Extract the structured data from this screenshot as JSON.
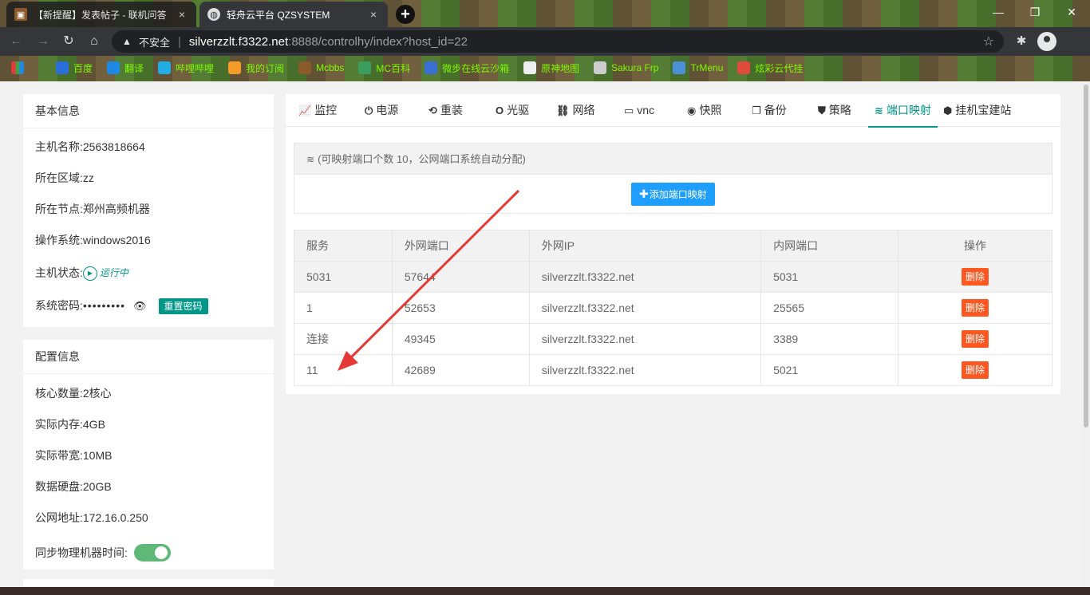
{
  "browser": {
    "tabs": [
      {
        "title": "【新提醒】发表帖子 - 联机问答",
        "active": false
      },
      {
        "title": "轻舟云平台 QZSYSTEM",
        "active": true
      }
    ],
    "address": {
      "security_label": "不安全",
      "host": "silverzzlt.f3322.net",
      "path": ":8888/controlhy/index?host_id=22"
    },
    "bookmarks": [
      {
        "label": "百度",
        "icon": "baidu-icon",
        "color": "#2a6ed8"
      },
      {
        "label": "翻译",
        "icon": "translate-icon",
        "color": "#1e88e5"
      },
      {
        "label": "哔哩哔哩",
        "icon": "bilibili-icon",
        "color": "#23ade5"
      },
      {
        "label": "我的订阅",
        "icon": "subscription-icon",
        "color": "#f59b2a"
      },
      {
        "label": "Mcbbs",
        "icon": "mcbbs-icon",
        "color": "#8b5a2b"
      },
      {
        "label": "MC百科",
        "icon": "mcmod-icon",
        "color": "#3a9d5d"
      },
      {
        "label": "微步在线云沙箱",
        "icon": "sandbox-icon",
        "color": "#3b6fd1"
      },
      {
        "label": "原神地图",
        "icon": "map-icon",
        "color": "#eeeeee"
      },
      {
        "label": "Sakura Frp",
        "icon": "sakura-icon",
        "color": "#cccccc"
      },
      {
        "label": "TrMenu",
        "icon": "trmenu-icon",
        "color": "#4a90d9"
      },
      {
        "label": "炫彩云代挂",
        "icon": "rocket-icon",
        "color": "#e04a3a"
      }
    ]
  },
  "basic_info": {
    "title": "基本信息",
    "rows": [
      {
        "label": "主机名称:",
        "value": "2563818664"
      },
      {
        "label": "所在区域:",
        "value": "zz"
      },
      {
        "label": "所在节点:",
        "value": "郑州高频机器"
      },
      {
        "label": "操作系统:",
        "value": "windows2016"
      }
    ],
    "status_label": "主机状态:",
    "status_value": "运行中",
    "password_label": "系统密码:",
    "password_mask": "•••••••••",
    "reset_label": "重置密码"
  },
  "config_info": {
    "title": "配置信息",
    "rows": [
      {
        "label": "核心数量:",
        "value": "2核心"
      },
      {
        "label": "实际内存:",
        "value": "4GB"
      },
      {
        "label": "实际带宽:",
        "value": "10MB"
      },
      {
        "label": "数据硬盘:",
        "value": "20GB"
      },
      {
        "label": "公网地址:",
        "value": "172.16.0.250"
      }
    ],
    "sync_label": "同步物理机器时间:",
    "sync_on": true
  },
  "control_tabs": [
    {
      "label": "监控",
      "icon": "chart-icon",
      "glyph": "📈"
    },
    {
      "label": "电源",
      "icon": "power-icon",
      "glyph": "⏻"
    },
    {
      "label": "重装",
      "icon": "retweet-icon",
      "glyph": "⟲"
    },
    {
      "label": "光驱",
      "icon": "disc-icon",
      "glyph": "O"
    },
    {
      "label": "网络",
      "icon": "sitemap-icon",
      "glyph": "⛓"
    },
    {
      "label": "vnc",
      "icon": "monitor-icon",
      "glyph": "▭"
    },
    {
      "label": "快照",
      "icon": "camera-icon",
      "glyph": "◉"
    },
    {
      "label": "备份",
      "icon": "copy-icon",
      "glyph": "❐"
    },
    {
      "label": "策略",
      "icon": "shield-icon",
      "glyph": "⛊"
    },
    {
      "label": "端口映射",
      "icon": "wifi-icon",
      "glyph": "≋",
      "active": true
    },
    {
      "label": "挂机宝建站",
      "icon": "cube-icon",
      "glyph": "⬢"
    }
  ],
  "port_mapping": {
    "notice": "(可映射端口个数 10，公网端口系统自动分配)",
    "add_label": "添加端口映射",
    "columns": [
      "服务",
      "外网端口",
      "外网IP",
      "内网端口",
      "操作"
    ],
    "rows": [
      {
        "service": "5031",
        "public_port": "57644",
        "public_ip": "silverzzlt.f3322.net",
        "private_port": "5031",
        "action": "删除"
      },
      {
        "service": "1",
        "public_port": "52653",
        "public_ip": "silverzzlt.f3322.net",
        "private_port": "25565",
        "action": "删除"
      },
      {
        "service": "连接",
        "public_port": "49345",
        "public_ip": "silverzzlt.f3322.net",
        "private_port": "3389",
        "action": "删除"
      },
      {
        "service": "11",
        "public_port": "42689",
        "public_ip": "silverzzlt.f3322.net",
        "private_port": "5021",
        "action": "删除"
      }
    ]
  },
  "colors": {
    "accent": "#009688",
    "primary_button": "#1e9fff",
    "danger": "#ff5722",
    "annotation_arrow": "#e53935"
  }
}
